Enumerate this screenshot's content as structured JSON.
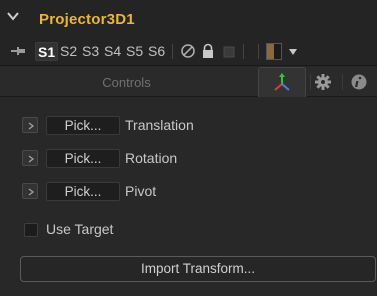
{
  "header": {
    "title": "Projector3D1",
    "collapse_icon": "chevron-down-icon",
    "title_color": "#ebb43c"
  },
  "toolbar": {
    "pin_icon": "pin-icon",
    "slots": [
      "S1",
      "S2",
      "S3",
      "S4",
      "S5",
      "S6"
    ],
    "active_slot": "S1",
    "icons": [
      "disable-icon",
      "lock-icon",
      "reset-icon",
      "color-swatch",
      "dropdown-icon"
    ]
  },
  "tabs": {
    "controls_label": "Controls",
    "active_tab": "3d-transform",
    "icons": [
      "3d-axes-icon",
      "gear-icon",
      "info-icon"
    ]
  },
  "transform_rows": [
    {
      "pick_label": "Pick...",
      "label": "Translation"
    },
    {
      "pick_label": "Pick...",
      "label": "Rotation"
    },
    {
      "pick_label": "Pick...",
      "label": "Pivot"
    }
  ],
  "use_target": {
    "label": "Use Target",
    "checked": false
  },
  "import_button": {
    "label": "Import Transform..."
  },
  "colors": {
    "background": "#282828",
    "panel": "#242424",
    "accent_title": "#ebb43c",
    "axis_x": "#e03a3a",
    "axis_y": "#3ec03e",
    "axis_z": "#4a7de0"
  }
}
